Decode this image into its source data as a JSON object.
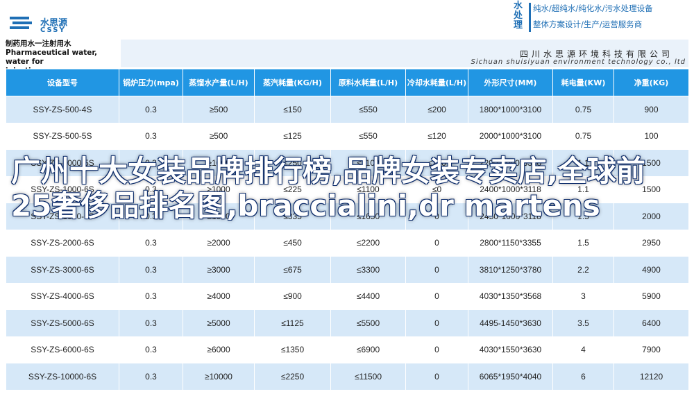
{
  "header": {
    "logo_cn": "水思源",
    "logo_en": "CSSY",
    "tagline_big": "水处理",
    "tagline_line1": "纯水/超纯水/纯化水/污水处理设备",
    "tagline_line2": "整体方案设计/生产/运营服务商"
  },
  "band": {
    "title_cn": "制药用水一注射用水",
    "title_en_1": "Pharmaceutical water, water for",
    "title_en_2": "injection",
    "company_cn": "四川水思源环境科技有限公司",
    "company_en": "Sichuan shuisiyuan environment technology co., ltd"
  },
  "colors": {
    "accent": "#2196e3",
    "row_alt": "#d6e8f8",
    "brand": "#1f6fb5"
  },
  "table": {
    "headers": [
      "设备型号",
      "锅炉压力(mpa)",
      "蒸馏水产量(L/H)",
      "蒸汽耗量(KG/H)",
      "原料水耗量(L/H)",
      "冷却水耗量(L/H)",
      "外形尺寸(MM)",
      "耗电量(KW)",
      "净重(KG)"
    ],
    "rows": [
      [
        "SSY-ZS-500-4S",
        "0.3",
        "≥500",
        "≤150",
        "≤550",
        "≤200",
        "1800*1000*3100",
        "0.75",
        "900"
      ],
      [
        "SSY-ZS-500-5S",
        "0.3",
        "≥500",
        "≤125",
        "≤550",
        "≤120",
        "2000*1000*3100",
        "0.75",
        "100"
      ],
      [
        "SSY-ZS-1000-5S",
        "0.3",
        "≥1000",
        "≤250",
        "≤1100",
        "≤250",
        "2200*1000*3380",
        "1.1",
        "1500"
      ],
      [
        "SSY-ZS-1000-6S",
        "0.3",
        "≥1000",
        "≤225",
        "≤1100",
        "≤0",
        "2400*1000*3118",
        "1.1",
        "1500"
      ],
      [
        "SSY-ZS-1500-6S",
        "0.3",
        "≥1500",
        "≤335",
        "≤1650",
        "0",
        "2450*1000*3118",
        "1.5",
        "2000"
      ],
      [
        "SSY-ZS-2000-6S",
        "0.3",
        "≥2000",
        "≤450",
        "≤2200",
        "0",
        "2800*1150*3355",
        "1.5",
        "2950"
      ],
      [
        "SSY-ZS-3000-6S",
        "0.3",
        "≥3000",
        "≤675",
        "≤3300",
        "0",
        "3810*1250*3780",
        "2.2",
        "4900"
      ],
      [
        "SSY-ZS-4000-6S",
        "0.3",
        "≥4000",
        "≤900",
        "≤4400",
        "0",
        "4030*1350*3568",
        "3",
        "5900"
      ],
      [
        "SSY-ZS-5000-6S",
        "0.3",
        "≥5000",
        "≤1125",
        "≤5500",
        "0",
        "4495-1450*3630",
        "3.5",
        "6400"
      ],
      [
        "SSY-ZS-6000-6S",
        "0.3",
        "≥6000",
        "≤1350",
        "≤6900",
        "0",
        "4030*1550*3630",
        "4",
        "7900"
      ],
      [
        "SSY-ZS-10000-6S",
        "0.3",
        "≥10000",
        "≤2250",
        "≤11500",
        "0",
        "6065*1950*4040",
        "6",
        "12120"
      ]
    ]
  },
  "overlay": {
    "title": "广州十大女装品牌排行榜,品牌女装专卖店,全球前25奢侈品排名图,braccialini,dr martens"
  }
}
